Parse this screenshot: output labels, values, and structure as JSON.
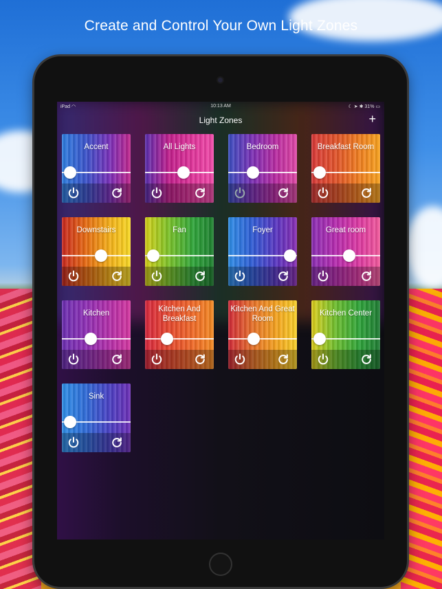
{
  "headline": "Create and Control Your Own Light Zones",
  "status_bar": {
    "left": "iPad",
    "time": "10:13 AM",
    "battery": "31%"
  },
  "nav": {
    "title": "Light Zones",
    "add_label": "+"
  },
  "zones": [
    {
      "label": "Accent",
      "level": 0.12,
      "power_dim": false,
      "colors": [
        "#2f7fe0",
        "#3a52c9",
        "#7a2fb8",
        "#c1278b"
      ]
    },
    {
      "label": "All Lights",
      "level": 0.56,
      "power_dim": false,
      "colors": [
        "#5a2fb0",
        "#c11f8b",
        "#e0359a",
        "#f04aa9"
      ]
    },
    {
      "label": "Bedroom",
      "level": 0.36,
      "power_dim": true,
      "colors": [
        "#3a4fc0",
        "#7b2fb4",
        "#b92ba0",
        "#e04aa6"
      ]
    },
    {
      "label": "Breakfast Room",
      "level": 0.12,
      "power_dim": false,
      "colors": [
        "#d83a3a",
        "#e0522a",
        "#ef7f20",
        "#f6a21f"
      ]
    },
    {
      "label": "Downstairs",
      "level": 0.57,
      "power_dim": false,
      "colors": [
        "#c8281f",
        "#e56a12",
        "#f3b019",
        "#f6d826"
      ]
    },
    {
      "label": "Fan",
      "level": 0.12,
      "power_dim": false,
      "colors": [
        "#d7d119",
        "#7ac12a",
        "#2fa43a",
        "#1e7f2f"
      ]
    },
    {
      "label": "Foyer",
      "level": 0.9,
      "power_dim": false,
      "colors": [
        "#2f8fe6",
        "#2f5bd3",
        "#5a35c0",
        "#8a2fb3"
      ]
    },
    {
      "label": "Great room",
      "level": 0.55,
      "power_dim": false,
      "colors": [
        "#8a2fb3",
        "#b52bae",
        "#dd3aa1",
        "#f05a9a"
      ]
    },
    {
      "label": "Kitchen",
      "level": 0.42,
      "power_dim": false,
      "colors": [
        "#6b2fb0",
        "#8e2fb4",
        "#b42fa8",
        "#d3379e"
      ]
    },
    {
      "label": "Kitchen And Breakfast",
      "level": 0.32,
      "power_dim": false,
      "colors": [
        "#d8283f",
        "#e5482f",
        "#ef6a28",
        "#f28a22"
      ]
    },
    {
      "label": "Kitchen And Great Room",
      "level": 0.37,
      "power_dim": false,
      "colors": [
        "#d02a3a",
        "#e5702a",
        "#f3a21f",
        "#f7d02a"
      ]
    },
    {
      "label": "Kitchen Center",
      "level": 0.12,
      "power_dim": false,
      "colors": [
        "#e0cf1d",
        "#6dbd2e",
        "#2ea33a",
        "#1f7a33"
      ]
    },
    {
      "label": "Sink",
      "level": 0.12,
      "power_dim": false,
      "colors": [
        "#2f8fe6",
        "#2f6ad6",
        "#4a3fc2",
        "#6e2fb5"
      ]
    }
  ],
  "icons": {
    "power": "power-icon",
    "refresh": "refresh-icon",
    "add": "plus-icon",
    "wifi": "wifi-icon",
    "battery": "battery-icon"
  }
}
